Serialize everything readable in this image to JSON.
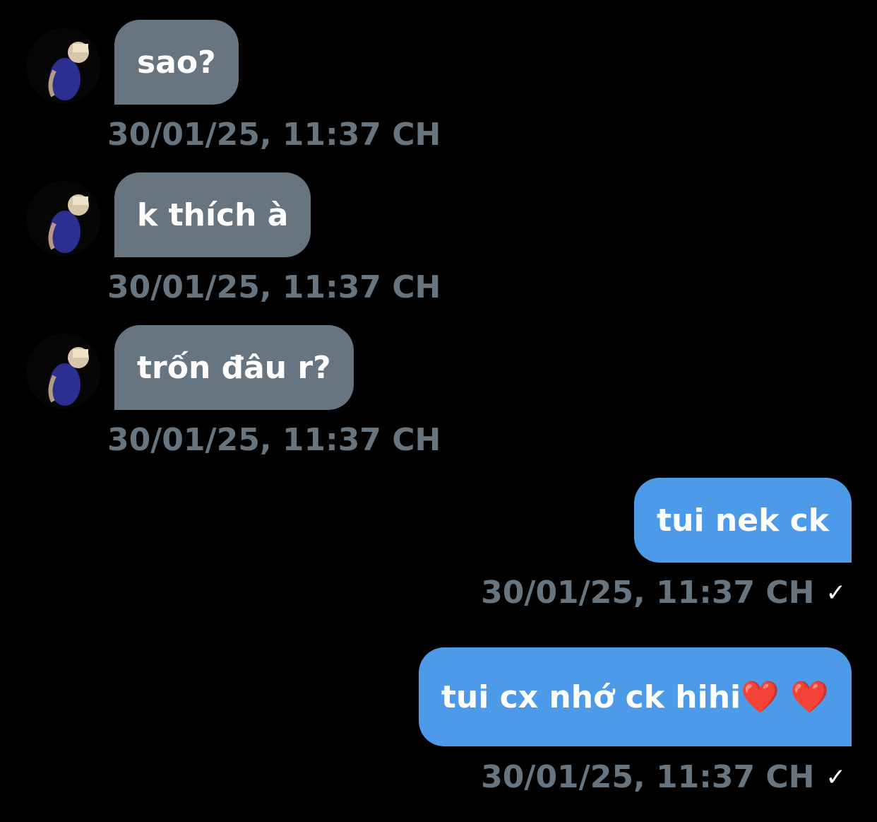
{
  "messages": [
    {
      "direction": "in",
      "text": "sao?",
      "time": "30/01/25, 11:37 CH"
    },
    {
      "direction": "in",
      "text": "k thích à",
      "time": "30/01/25, 11:37 CH"
    },
    {
      "direction": "in",
      "text": "trốn đâu r?",
      "time": "30/01/25, 11:37 CH"
    },
    {
      "direction": "out",
      "text": "tui nek ck",
      "time": "30/01/25, 11:37 CH",
      "status_icon": "✓"
    },
    {
      "direction": "out",
      "text": "tui cx nhớ ck hihi❤️ ❤️",
      "time": "30/01/25, 11:37 CH",
      "status_icon": "✓"
    }
  ],
  "colors": {
    "background": "#000000",
    "incoming_bubble": "#66757f",
    "outgoing_bubble": "#4c9ae8",
    "timestamp": "#66757f",
    "text": "#ffffff"
  },
  "icons": {
    "avatar": "contact-avatar-photo",
    "read_status": "checkmark-icon"
  }
}
